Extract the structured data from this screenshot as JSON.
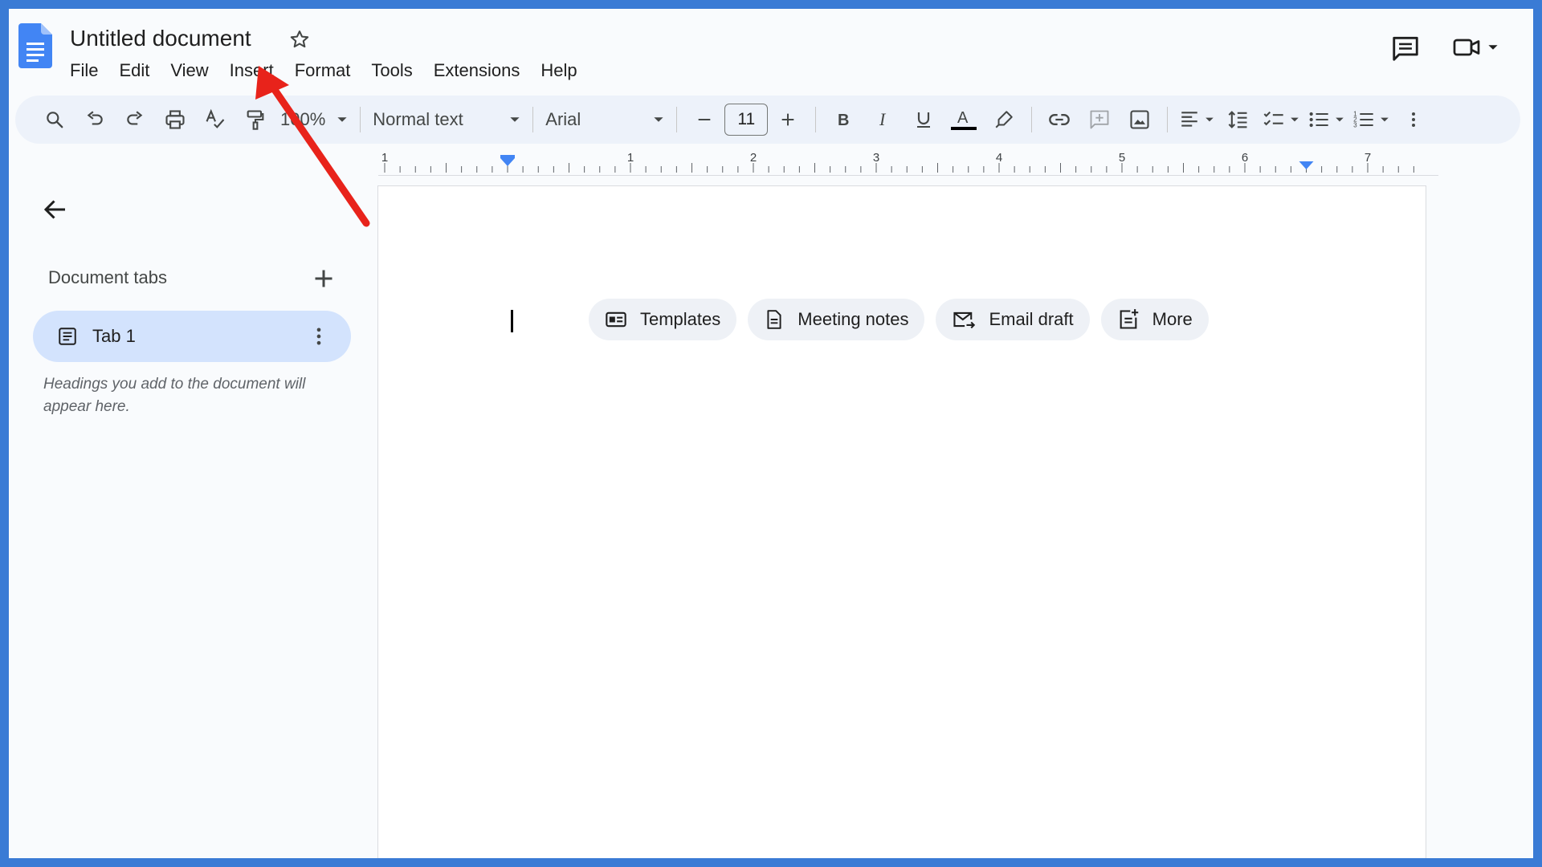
{
  "header": {
    "title": "Untitled document",
    "menu": [
      "File",
      "Edit",
      "View",
      "Insert",
      "Format",
      "Tools",
      "Extensions",
      "Help"
    ]
  },
  "toolbar": {
    "zoom": "100%",
    "style": "Normal text",
    "font": "Arial",
    "font_size": "11"
  },
  "ruler": {
    "labels": [
      "1",
      "1",
      "2",
      "3",
      "4",
      "5",
      "6",
      "7"
    ]
  },
  "sidebar": {
    "heading": "Document tabs",
    "tabs": [
      {
        "label": "Tab 1"
      }
    ],
    "hint": "Headings you add to the document will appear here."
  },
  "page": {
    "chips": [
      {
        "label": "Templates",
        "icon": "templates-icon"
      },
      {
        "label": "Meeting notes",
        "icon": "meeting-notes-icon"
      },
      {
        "label": "Email draft",
        "icon": "email-draft-icon"
      },
      {
        "label": "More",
        "icon": "more-building-blocks-icon"
      }
    ]
  },
  "colors": {
    "frame": "#3a7bd5",
    "toolbar_bg": "#edf2fa",
    "tab_active": "#d3e3fd",
    "annotation_arrow": "#e8231b",
    "docs_blue": "#4285f4"
  }
}
